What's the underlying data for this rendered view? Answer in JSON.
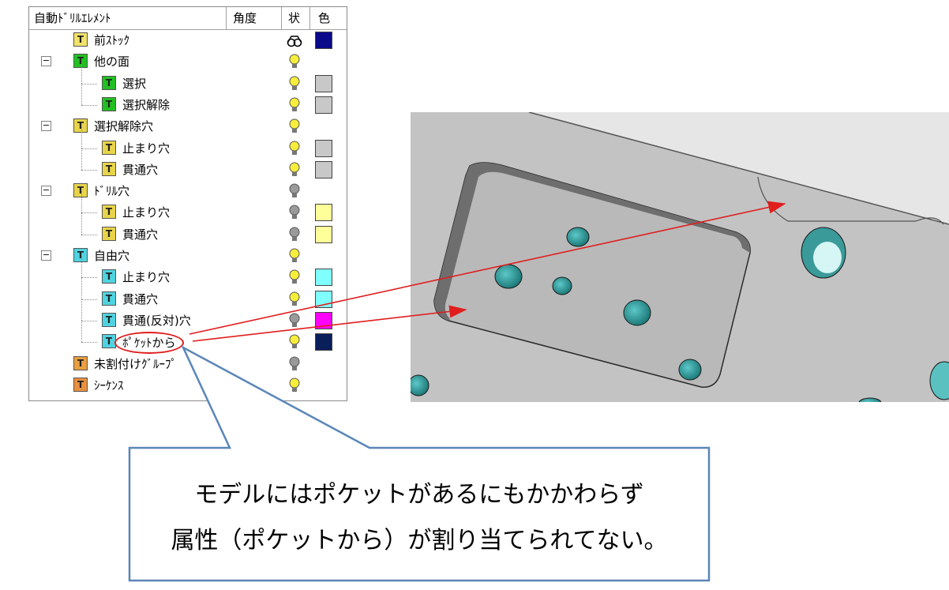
{
  "tree": {
    "headers": {
      "name": "自動ﾄﾞﾘﾙｴﾚﾒﾝﾄ",
      "angle": "角度",
      "state": "状",
      "color": "色"
    },
    "rows": [
      {
        "label": "前ｽﾄｯｸ",
        "icon": "stock-icon",
        "icon_color": "#f2e36a",
        "state": "glasses-icon",
        "swatch": "#0a0a8a"
      },
      {
        "label": "他の面",
        "icon": "face-icon",
        "icon_color": "#22c022",
        "expander": "-",
        "state": "bulb-on-icon",
        "swatch": ""
      },
      {
        "label": "選択",
        "icon": "face-icon",
        "icon_color": "#22c022",
        "state": "bulb-on-icon",
        "swatch": "#c8c8c8"
      },
      {
        "label": "選択解除",
        "icon": "face-icon",
        "icon_color": "#22c022",
        "state": "bulb-on-icon",
        "swatch": "#c8c8c8"
      },
      {
        "label": "選択解除穴",
        "icon": "hole-group-icon",
        "icon_color": "#e8d44a",
        "expander": "-",
        "state": "bulb-on-icon",
        "swatch": ""
      },
      {
        "label": "止まり穴",
        "icon": "blind-hole-icon",
        "icon_color": "#e8d44a",
        "state": "bulb-on-icon",
        "swatch": "#c8c8c8"
      },
      {
        "label": "貫通穴",
        "icon": "through-hole-icon",
        "icon_color": "#e8d44a",
        "state": "bulb-on-icon",
        "swatch": "#c8c8c8"
      },
      {
        "label": "ﾄﾞﾘﾙ穴",
        "icon": "hole-group-icon",
        "icon_color": "#e8d44a",
        "expander": "-",
        "state": "bulb-off-icon",
        "swatch": ""
      },
      {
        "label": "止まり穴",
        "icon": "blind-hole-icon",
        "icon_color": "#e8d44a",
        "state": "bulb-off-icon",
        "swatch": "#ffff99"
      },
      {
        "label": "貫通穴",
        "icon": "through-hole-icon",
        "icon_color": "#e8d44a",
        "state": "bulb-off-icon",
        "swatch": "#ffff99"
      },
      {
        "label": "自由穴",
        "icon": "hole-group-icon",
        "icon_color": "#4fd3e0",
        "expander": "-",
        "state": "bulb-on-icon",
        "swatch": ""
      },
      {
        "label": "止まり穴",
        "icon": "blind-hole-icon",
        "icon_color": "#4fd3e0",
        "state": "bulb-on-icon",
        "swatch": "#80ffff"
      },
      {
        "label": "貫通穴",
        "icon": "through-hole-icon",
        "icon_color": "#4fd3e0",
        "state": "bulb-on-icon",
        "swatch": "#80ffff"
      },
      {
        "label": "貫通(反対)穴",
        "icon": "reverse-hole-icon",
        "icon_color": "#4fd3e0",
        "state": "bulb-off-icon",
        "swatch": "#ff00ff"
      },
      {
        "label": "ﾎﾟｹｯﾄから",
        "icon": "pocket-icon",
        "icon_color": "#4fd3e0",
        "state": "bulb-on-icon",
        "swatch": "#0a1e5a",
        "highlighted": true
      },
      {
        "label": "未割付けｸﾞﾙｰﾌﾟ",
        "icon": "unassigned-group-icon",
        "icon_color": "#e8a040",
        "state": "bulb-off-icon",
        "swatch": ""
      },
      {
        "label": "ｼｰｹﾝｽ",
        "icon": "sequence-icon",
        "icon_color": "#e89040",
        "state": "bulb-on-icon",
        "swatch": ""
      }
    ]
  },
  "callout": {
    "line1": "モデルにはポケットがあるにもかかわらず",
    "line2": "属性（ポケットから）が割り当てられてない。"
  },
  "colors": {
    "arrow": "#e01e1e",
    "callout_border": "#5b86b8",
    "model_face": "#c0c0c0",
    "hole": "#3aa0a0"
  }
}
